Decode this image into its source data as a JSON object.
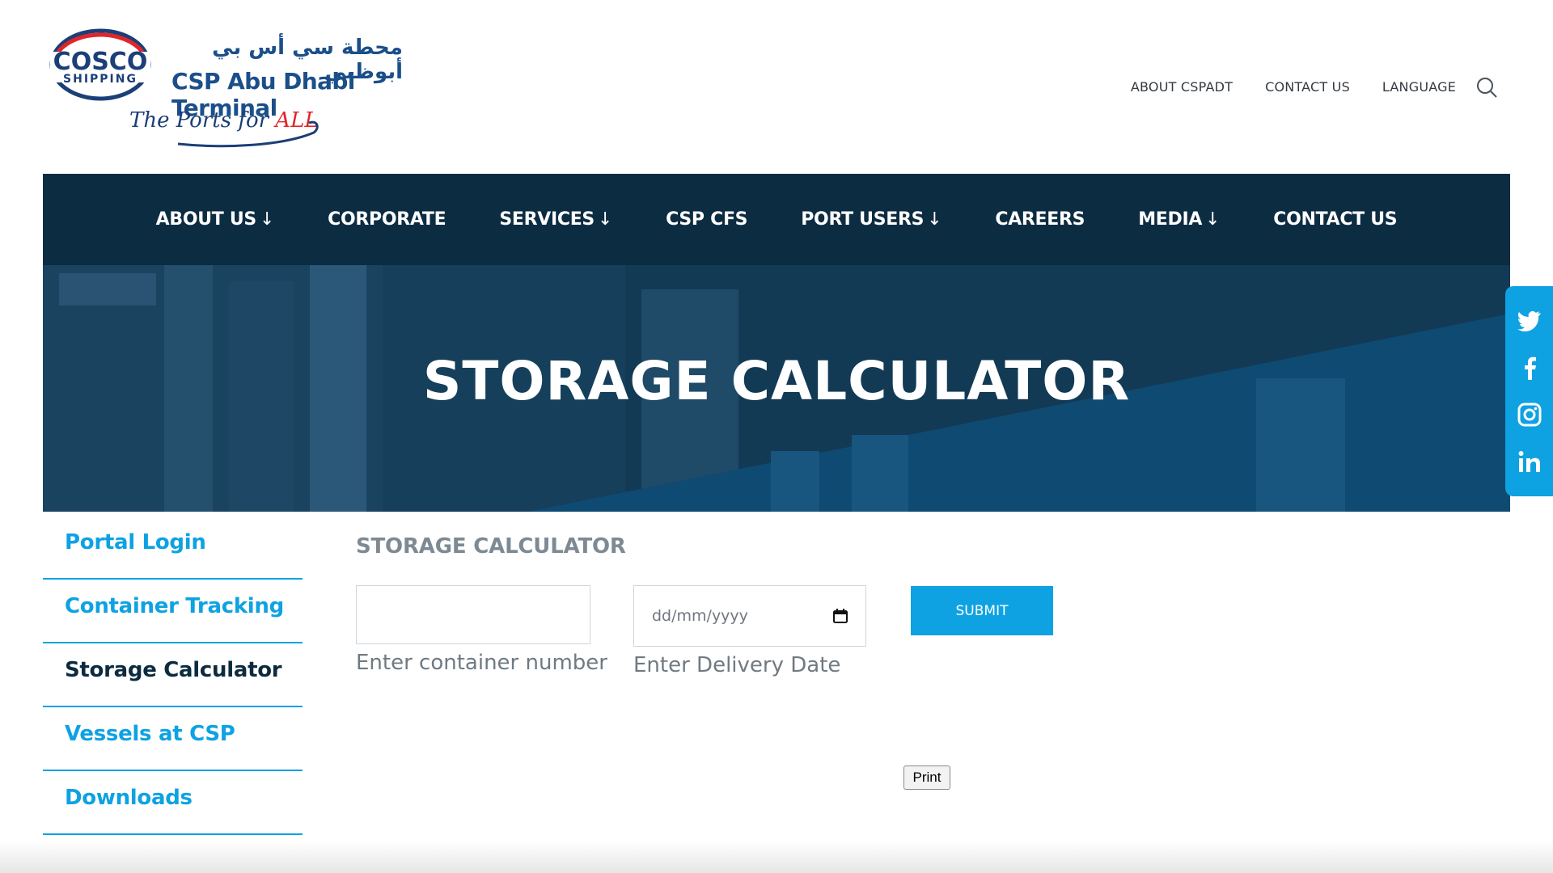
{
  "header": {
    "logo_text_top": "COSCO",
    "logo_text_bottom": "SHIPPING",
    "logo_arabic": "محطة سي أس بي أبوظبي",
    "logo_english": "CSP Abu Dhabi Terminal",
    "tagline_main": "The Ports for ",
    "tagline_accent": "ALL",
    "top_links": [
      "ABOUT CSPADT",
      "CONTACT US",
      "LANGUAGE"
    ]
  },
  "nav": {
    "items": [
      {
        "label": "ABOUT US",
        "arrow": "↓"
      },
      {
        "label": "CORPORATE",
        "arrow": ""
      },
      {
        "label": "SERVICES",
        "arrow": "↓"
      },
      {
        "label": "CSP CFS",
        "arrow": ""
      },
      {
        "label": "PORT USERS",
        "arrow": "↓"
      },
      {
        "label": "CAREERS",
        "arrow": ""
      },
      {
        "label": "MEDIA",
        "arrow": "↓"
      },
      {
        "label": "CONTACT US",
        "arrow": ""
      }
    ]
  },
  "hero": {
    "title": "STORAGE CALCULATOR"
  },
  "social": [
    "twitter-icon",
    "facebook-icon",
    "instagram-icon",
    "linkedin-icon"
  ],
  "sidebar": {
    "items": [
      {
        "label": "Portal Login"
      },
      {
        "label": "Container Tracking"
      },
      {
        "label": "Storage Calculator"
      },
      {
        "label": "Vessels at CSP"
      },
      {
        "label": "Downloads"
      }
    ],
    "active_label": "Storage Calculator"
  },
  "content": {
    "title": "STORAGE CALCULATOR",
    "container_value": "",
    "container_help": "Enter container number",
    "date_placeholder": "dd/mm/yyyy",
    "date_help": "Enter Delivery Date",
    "submit_label": "SUBMIT",
    "print_label": "Print"
  },
  "colors": {
    "brand_dark": "#0c2c42",
    "accent": "#0ea2e2",
    "muted": "#7d8a94"
  }
}
